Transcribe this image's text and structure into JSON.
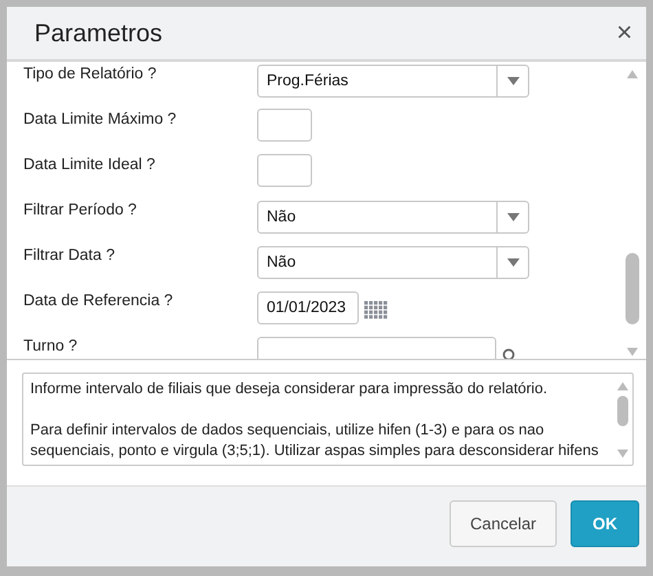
{
  "window": {
    "title": "Parametros",
    "close": "×"
  },
  "fields": [
    {
      "label": "Tipo de Relatório ?",
      "kind": "select",
      "value": "Prog.Férias"
    },
    {
      "label": "Data Limite Máximo ?",
      "kind": "short"
    },
    {
      "label": "Data Limite Ideal ?",
      "kind": "short"
    },
    {
      "label": "Filtrar Período ?",
      "kind": "select",
      "value": "Não"
    },
    {
      "label": "Filtrar Data ?",
      "kind": "select",
      "value": "Não"
    },
    {
      "label": "Data de Referencia ?",
      "kind": "date",
      "value": "01/01/2023"
    },
    {
      "label": "Turno ?",
      "kind": "lookup"
    }
  ],
  "help": [
    "Informe intervalo de filiais que deseja considerar para impressão do relatório.",
    "Para definir intervalos de dados sequenciais, utilize hifen (1-3) e para os nao sequenciais, ponto e virgula (3;5;1). Utilizar aspas simples para desconsiderar hifens"
  ],
  "buttons": [
    {
      "label": "Cancelar",
      "kind": "secondary"
    },
    {
      "label": "OK",
      "kind": "primary"
    }
  ]
}
